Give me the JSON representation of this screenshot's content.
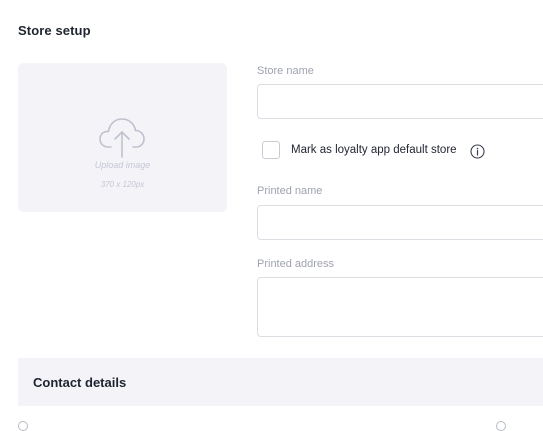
{
  "section": {
    "title": "Store setup"
  },
  "upload": {
    "title": "Upload image",
    "size": "370 x 120px",
    "icon": "cloud-upload-icon"
  },
  "form": {
    "store_name": {
      "label": "Store name",
      "value": ""
    },
    "loyalty_default": {
      "label": "Mark as loyalty app default store",
      "checked": false,
      "info_icon": "info-icon"
    },
    "printed_name": {
      "label": "Printed name",
      "value": ""
    },
    "printed_address": {
      "label": "Printed address",
      "value": ""
    }
  },
  "contact": {
    "title": "Contact details"
  },
  "colors": {
    "text": "#1f2430",
    "muted_label": "#9fa3b0",
    "panel_bg": "#f3f3f8",
    "input_border": "#dcdde3"
  }
}
